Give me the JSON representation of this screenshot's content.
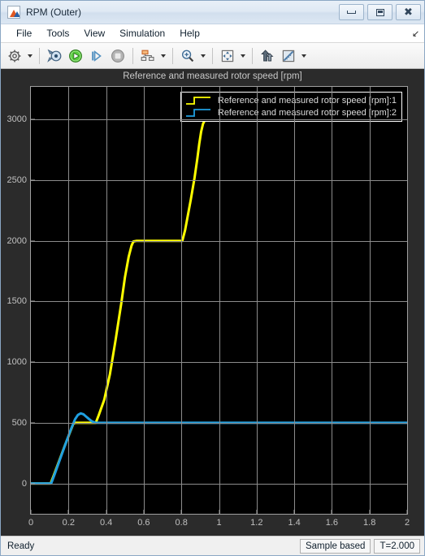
{
  "window": {
    "title": "RPM (Outer)",
    "icon": "matlab-scope-icon",
    "controls": {
      "minimize": "minimize-button",
      "restore": "restore-button",
      "close": "close-button"
    }
  },
  "menubar": {
    "items": [
      {
        "label": "File",
        "name": "menu-file"
      },
      {
        "label": "Tools",
        "name": "menu-tools"
      },
      {
        "label": "View",
        "name": "menu-view"
      },
      {
        "label": "Simulation",
        "name": "menu-simulation"
      },
      {
        "label": "Help",
        "name": "menu-help"
      }
    ],
    "overflow_arrow": "↘"
  },
  "toolbar": {
    "buttons": [
      {
        "name": "configuration-properties-icon",
        "has_caret": true
      },
      {
        "name": "run-simulation-fast-icon",
        "has_caret": false
      },
      {
        "name": "run-icon",
        "has_caret": false
      },
      {
        "name": "step-forward-icon",
        "has_caret": false
      },
      {
        "name": "stop-icon",
        "has_caret": false
      },
      {
        "name": "signal-selector-icon",
        "has_caret": true
      },
      {
        "name": "zoom-in-icon",
        "has_caret": true
      },
      {
        "name": "autoscale-icon",
        "has_caret": true
      },
      {
        "name": "cursor-measurements-icon",
        "has_caret": false
      },
      {
        "name": "measurements-icon",
        "has_caret": true
      }
    ]
  },
  "statusbar": {
    "status": "Ready",
    "frame_mode": "Sample based",
    "time": "T=2.000"
  },
  "chart_data": {
    "type": "line",
    "title": "Reference and measured rotor speed [rpm]",
    "xlabel": "",
    "ylabel": "",
    "xlim": [
      0,
      2
    ],
    "ylim": [
      -250,
      3270
    ],
    "grid": true,
    "background": "#000000",
    "legend_position": "top-right",
    "xticks": [
      0,
      0.2,
      0.4,
      0.6,
      0.8,
      1,
      1.2,
      1.4,
      1.6,
      1.8,
      2
    ],
    "xticklabels": [
      "0",
      "0.2",
      "0.4",
      "0.6",
      "0.8",
      "1",
      "1.2",
      "1.4",
      "1.6",
      "1.8",
      "2"
    ],
    "yticks": [
      0,
      500,
      1000,
      1500,
      2000,
      2500,
      3000
    ],
    "yticklabels": [
      "0",
      "500",
      "1000",
      "1500",
      "2000",
      "2500",
      "3000"
    ],
    "series": [
      {
        "name": "Reference and measured rotor speed [rpm]:1",
        "color": "#ffff00",
        "points": [
          [
            0.0,
            0
          ],
          [
            0.1,
            0
          ],
          [
            0.105,
            0
          ],
          [
            0.12,
            60
          ],
          [
            0.15,
            185
          ],
          [
            0.18,
            310
          ],
          [
            0.21,
            430
          ],
          [
            0.225,
            490
          ],
          [
            0.235,
            500
          ],
          [
            0.25,
            500
          ],
          [
            0.3,
            500
          ],
          [
            0.345,
            500
          ],
          [
            0.36,
            560
          ],
          [
            0.39,
            690
          ],
          [
            0.42,
            900
          ],
          [
            0.45,
            1180
          ],
          [
            0.48,
            1480
          ],
          [
            0.5,
            1700
          ],
          [
            0.52,
            1870
          ],
          [
            0.535,
            1960
          ],
          [
            0.545,
            1995
          ],
          [
            0.56,
            2000
          ],
          [
            0.6,
            2000
          ],
          [
            0.7,
            2000
          ],
          [
            0.8,
            2000
          ],
          [
            0.805,
            2000
          ],
          [
            0.82,
            2090
          ],
          [
            0.85,
            2340
          ],
          [
            0.87,
            2520
          ],
          [
            0.885,
            2680
          ],
          [
            0.895,
            2800
          ],
          [
            0.905,
            2900
          ],
          [
            0.915,
            2965
          ],
          [
            0.925,
            2995
          ],
          [
            0.935,
            3000
          ],
          [
            0.96,
            3000
          ],
          [
            1.0,
            3000
          ],
          [
            1.05,
            3000
          ],
          [
            1.1,
            3000
          ],
          [
            1.15,
            3000
          ]
        ]
      },
      {
        "name": "Reference and measured rotor speed [rpm]:2",
        "color": "#1f9fe0",
        "points": [
          [
            0.0,
            0
          ],
          [
            0.05,
            0
          ],
          [
            0.1,
            0
          ],
          [
            0.108,
            0
          ],
          [
            0.125,
            70
          ],
          [
            0.155,
            200
          ],
          [
            0.185,
            330
          ],
          [
            0.215,
            455
          ],
          [
            0.235,
            530
          ],
          [
            0.25,
            565
          ],
          [
            0.265,
            578
          ],
          [
            0.28,
            570
          ],
          [
            0.295,
            550
          ],
          [
            0.31,
            530
          ],
          [
            0.325,
            512
          ],
          [
            0.34,
            503
          ],
          [
            0.35,
            500
          ],
          [
            0.4,
            500
          ],
          [
            0.5,
            500
          ],
          [
            0.6,
            500
          ],
          [
            0.7,
            500
          ],
          [
            0.8,
            500
          ],
          [
            0.9,
            500
          ],
          [
            1.0,
            500
          ],
          [
            1.05,
            500
          ],
          [
            1.1,
            500
          ],
          [
            1.2,
            500
          ],
          [
            1.3,
            500
          ],
          [
            1.4,
            500
          ],
          [
            1.5,
            500
          ],
          [
            1.6,
            500
          ],
          [
            1.7,
            500
          ],
          [
            1.8,
            500
          ],
          [
            1.9,
            500
          ],
          [
            2.0,
            500
          ]
        ]
      }
    ]
  }
}
